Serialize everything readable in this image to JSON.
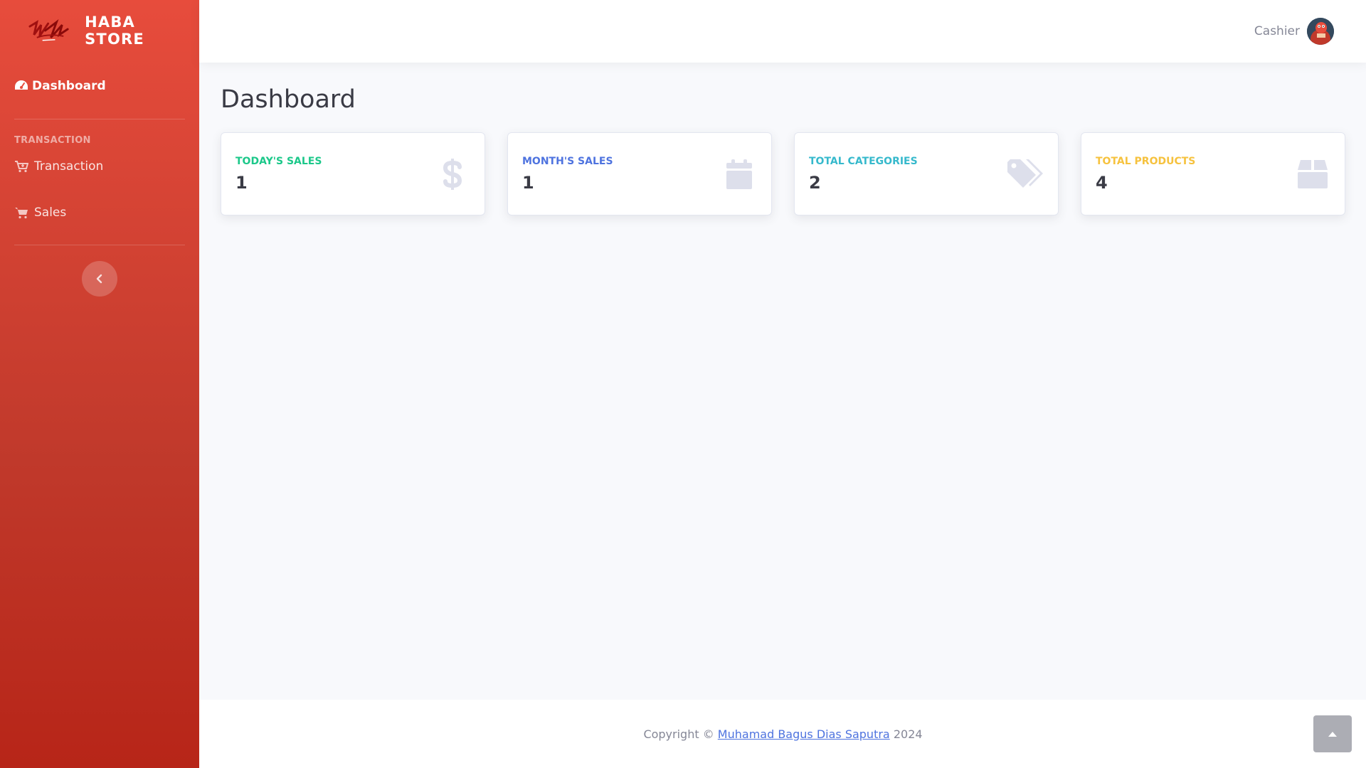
{
  "brand": {
    "name": "HABA STORE"
  },
  "sidebar": {
    "dashboard_label": "Dashboard",
    "section_heading": "TRANSACTION",
    "items": [
      {
        "label": "Transaction",
        "icon": "cart-plus-icon"
      },
      {
        "label": "Sales",
        "icon": "shopping-cart-icon"
      }
    ]
  },
  "topbar": {
    "user_name": "Cashier"
  },
  "main": {
    "page_title": "Dashboard",
    "cards": [
      {
        "label": "TODAY'S SALES",
        "value": "1",
        "icon": "dollar-icon",
        "color": "#1cc88a"
      },
      {
        "label": "MONTH'S SALES",
        "value": "1",
        "icon": "calendar-icon",
        "color": "#4e73df"
      },
      {
        "label": "TOTAL CATEGORIES",
        "value": "2",
        "icon": "tags-icon",
        "color": "#36b9cc"
      },
      {
        "label": "TOTAL PRODUCTS",
        "value": "4",
        "icon": "box-icon",
        "color": "#f6c23e"
      }
    ]
  },
  "footer": {
    "copyright_prefix": "Copyright ©",
    "author": "Muhamad Bagus Dias Saputra",
    "year": "2024"
  },
  "colors": {
    "sidebar_top": "#e74c3c",
    "sidebar_bottom": "#b72518",
    "background": "#f8f9fc"
  }
}
